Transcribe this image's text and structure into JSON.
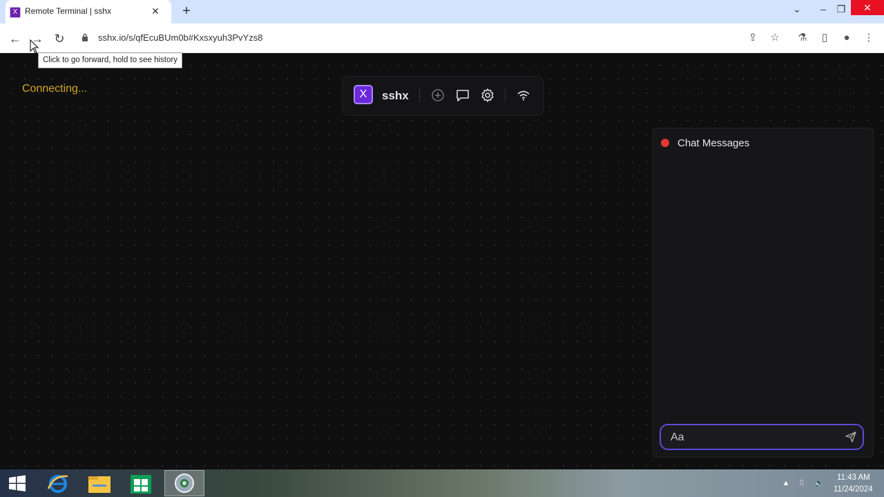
{
  "browser": {
    "tab_title": "Remote Terminal | sshx",
    "favicon_letter": "X",
    "url": "sshx.io/s/qfEcuBUm0b#Kxsxyuh3PvYzs8",
    "tooltip": "Click to go forward, hold to see history"
  },
  "app": {
    "status": "Connecting...",
    "logo_letter": "X",
    "brand": "sshx",
    "toolbar_icons": [
      "add-circle-icon",
      "chat-icon",
      "gear-icon",
      "wifi-icon"
    ],
    "status_color": "#d4a92b",
    "accent_color": "#6d28d9"
  },
  "chat": {
    "title": "Chat Messages",
    "status_dot_color": "#e53935",
    "input_placeholder": "Aa",
    "input_value": ""
  },
  "taskbar": {
    "time": "11:43 AM",
    "date": "11/24/2024",
    "items": [
      "internet-explorer-icon",
      "file-explorer-icon",
      "store-icon",
      "browser-icon"
    ]
  }
}
